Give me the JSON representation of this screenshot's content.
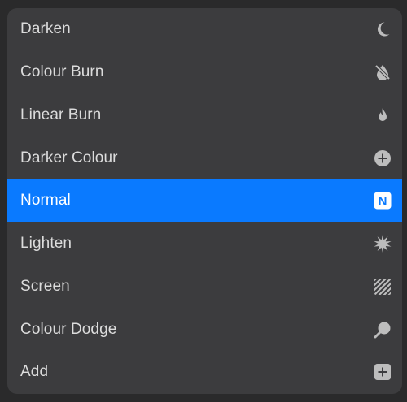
{
  "blend_menu": {
    "items": [
      {
        "label": "Darken",
        "icon": "crescent-moon-icon",
        "selected": false
      },
      {
        "label": "Colour Burn",
        "icon": "droplet-slash-icon",
        "selected": false
      },
      {
        "label": "Linear Burn",
        "icon": "flame-icon",
        "selected": false
      },
      {
        "label": "Darker Colour",
        "icon": "plus-circle-icon",
        "selected": false
      },
      {
        "label": "Normal",
        "icon": "n-badge-icon",
        "selected": true,
        "badge_letter": "N"
      },
      {
        "label": "Lighten",
        "icon": "starburst-icon",
        "selected": false
      },
      {
        "label": "Screen",
        "icon": "hatched-square-icon",
        "selected": false
      },
      {
        "label": "Colour Dodge",
        "icon": "magnifier-icon",
        "selected": false
      },
      {
        "label": "Add",
        "icon": "plus-square-icon",
        "selected": false
      }
    ]
  },
  "colors": {
    "panel": "#3c3c3e",
    "selected": "#0a7aff",
    "text": "#dcdcdc",
    "icon": "#bdbdbd"
  }
}
